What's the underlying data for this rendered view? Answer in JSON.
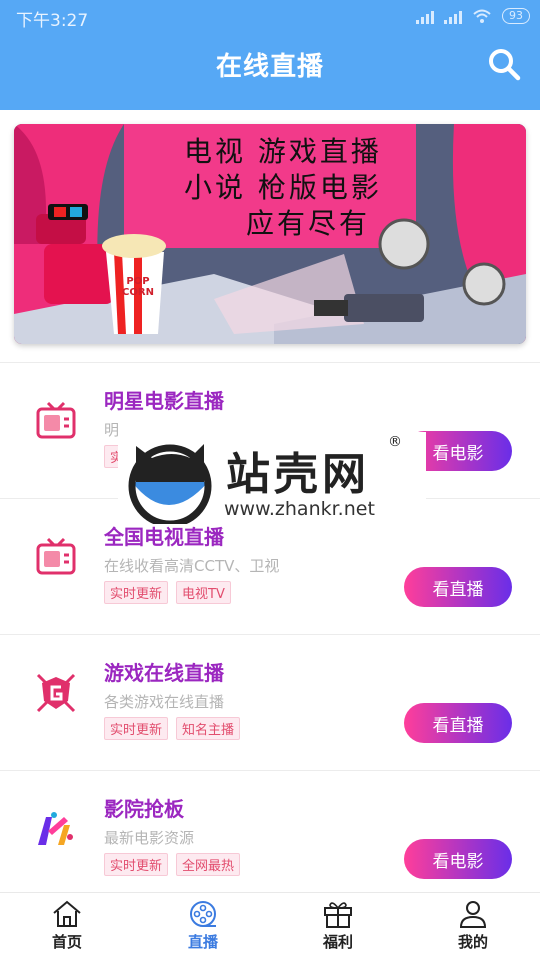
{
  "status_bar": {
    "time": "下午3:27",
    "battery": "93"
  },
  "header": {
    "title": "在线直播",
    "search_icon": "search-icon"
  },
  "banner": {
    "line1": "电视  游戏直播",
    "line2": "小说  枪版电影",
    "line3": "应有尽有",
    "popcorn_text": "POP CORN"
  },
  "cards": [
    {
      "title": "明星电影直播",
      "subtitle": "明",
      "tags": [
        "实时更新"
      ],
      "button": "看电影",
      "icon": "tv-icon"
    },
    {
      "title": "全国电视直播",
      "subtitle": "在线收看高清CCTV、卫视",
      "tags": [
        "实时更新",
        "电视TV"
      ],
      "button": "看直播",
      "icon": "tv-icon"
    },
    {
      "title": "游戏在线直播",
      "subtitle": "各类游戏在线直播",
      "tags": [
        "实时更新",
        "知名主播"
      ],
      "button": "看直播",
      "icon": "game-shield-icon"
    },
    {
      "title": "影院抢板",
      "subtitle": "最新电影资源",
      "tags": [
        "实时更新",
        "全网最热"
      ],
      "button": "看电影",
      "icon": "cinema-logo-icon"
    }
  ],
  "watermark": {
    "brand": "站壳网",
    "reg": "®",
    "url": "www.zhankr.net"
  },
  "nav": [
    {
      "label": "首页",
      "icon": "home-icon",
      "active": false
    },
    {
      "label": "直播",
      "icon": "film-reel-icon",
      "active": true
    },
    {
      "label": "福利",
      "icon": "gift-icon",
      "active": false
    },
    {
      "label": "我的",
      "icon": "user-icon",
      "active": false
    }
  ],
  "colors": {
    "header": "#56a8f5",
    "title_purple": "#9b27c0",
    "button_start": "#ff3e9a",
    "button_end": "#6a2ee8",
    "nav_active": "#3b7be0"
  }
}
